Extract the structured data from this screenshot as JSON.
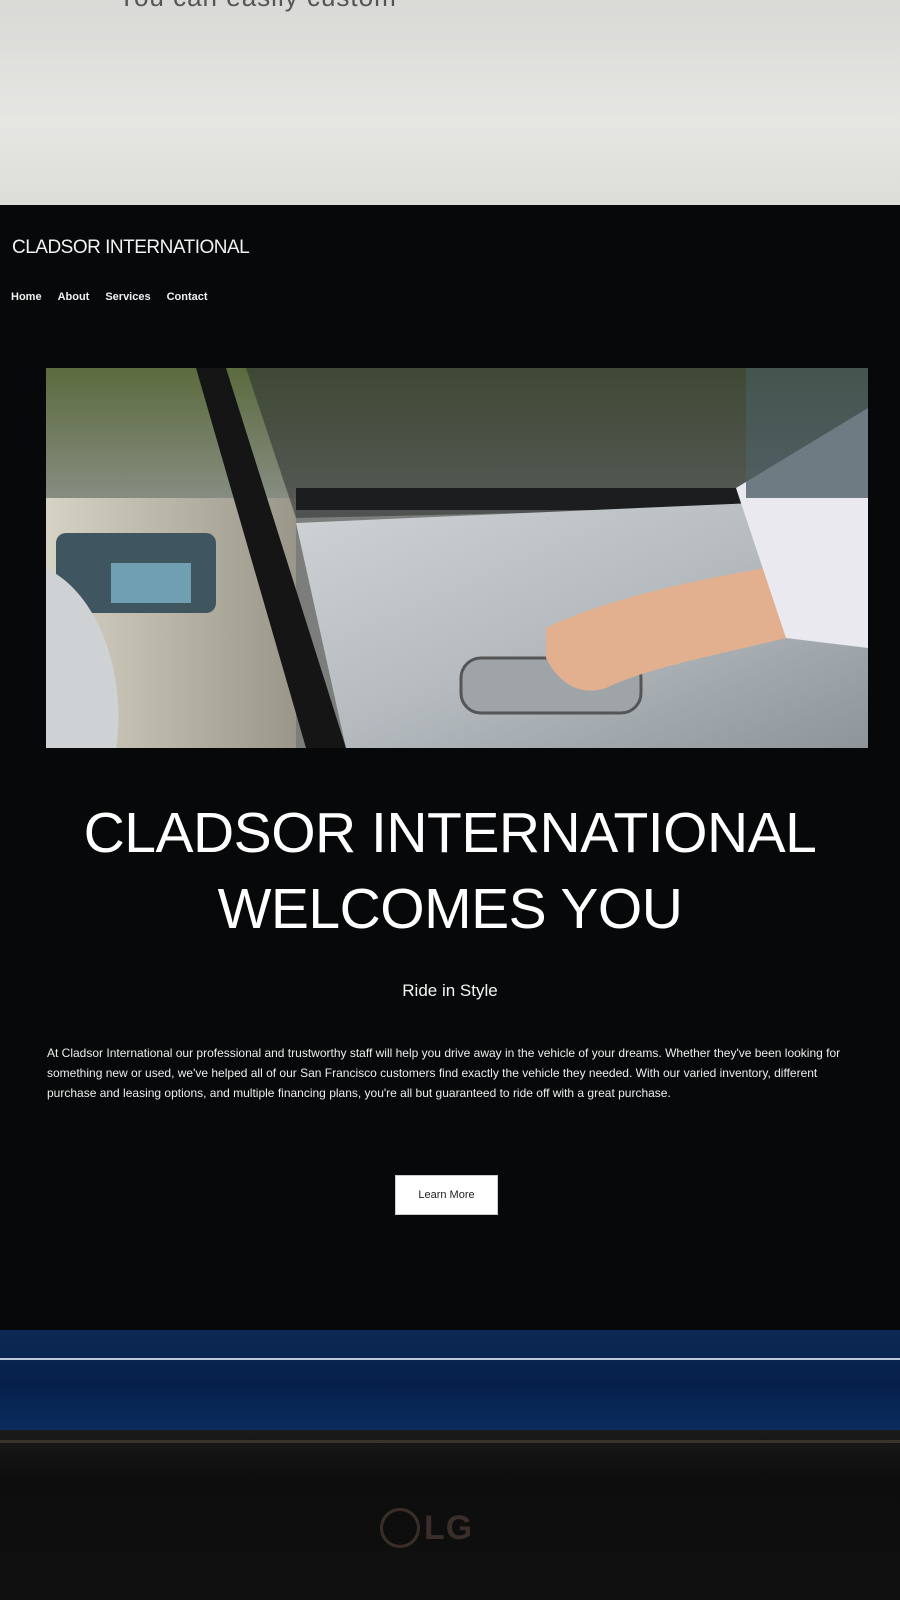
{
  "top_partial_text": "You can easily custom",
  "site": {
    "brand": "CLADSOR INTERNATIONAL",
    "nav": [
      "Home",
      "About",
      "Services",
      "Contact"
    ],
    "headline_line1": "CLADSOR INTERNATIONAL",
    "headline_line2": "WELCOMES YOU",
    "subhead": "Ride in Style",
    "body": "At Cladsor International our professional and trustworthy staff will help you drive away in the vehicle of your dreams. Whether they've been looking for something new or used, we've helped all of our San Francisco customers find exactly the vehicle they needed. With our varied inventory, different purchase and leasing options, and multiple financing plans, you're all but guaranteed to ride off with a great purchase.",
    "cta_label": "Learn More"
  },
  "monitor": {
    "brand": "LG"
  },
  "colors": {
    "site_background": "#070809",
    "footer_blue": "#06204b",
    "button_bg": "#ffffff"
  }
}
